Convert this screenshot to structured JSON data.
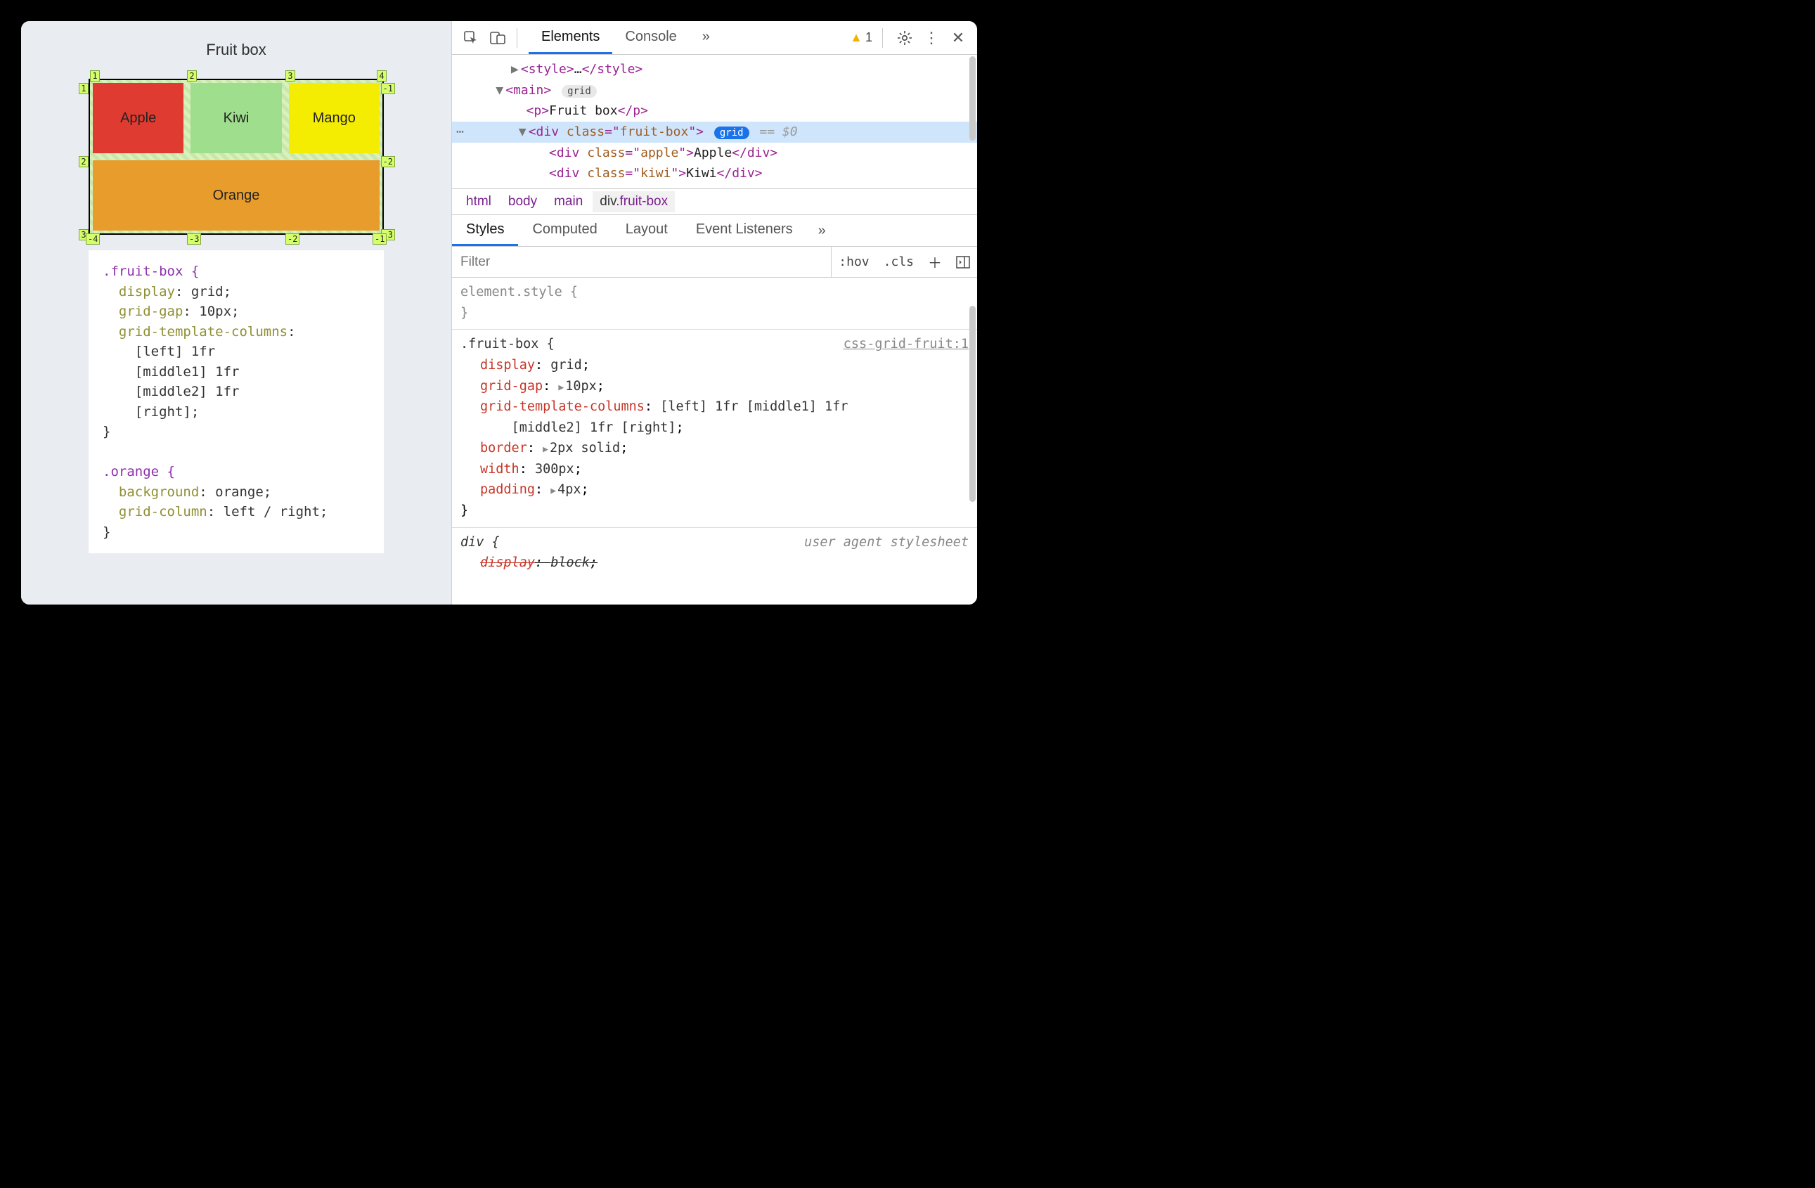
{
  "viewport": {
    "title": "Fruit box",
    "cells": {
      "apple": "Apple",
      "kiwi": "Kiwi",
      "mango": "Mango",
      "orange": "Orange"
    },
    "grid_numbers": {
      "top": [
        "1",
        "2",
        "3",
        "4"
      ],
      "left": [
        "1",
        "2",
        "3"
      ],
      "right": [
        "-1",
        "-2",
        "-3"
      ],
      "bottom": [
        "-4",
        "-3",
        "-2",
        "-1"
      ]
    },
    "css_sample": {
      "rule1_selector": ".fruit-box {",
      "rule1_lines": [
        "display: grid;",
        "grid-gap: 10px;",
        "grid-template-columns:",
        "  [left] 1fr",
        "  [middle1] 1fr",
        "  [middle2] 1fr",
        "  [right];"
      ],
      "rule1_close": "}",
      "rule2_selector": ".orange {",
      "rule2_lines": [
        "background: orange;",
        "grid-column: left / right;"
      ],
      "rule2_close": "}"
    }
  },
  "devtools": {
    "tabs": {
      "elements": "Elements",
      "console": "Console"
    },
    "more_chevrons": "»",
    "warning_count": "1",
    "dom": {
      "l1": "▶<style>…</style>",
      "l2_open": "▼<main>",
      "grid_badge": "grid",
      "l3": "<p>Fruit box</p>",
      "l4_open_pre": "▼<div class=\"",
      "l4_class": "fruit-box",
      "l4_open_post": "\"> ",
      "l4_eq": " == $0",
      "l5_a": "<div class=\"",
      "l5_b": "apple",
      "l5_c": "\">Apple</div>",
      "l6_a": "<div class=\"",
      "l6_b": "kiwi",
      "l6_c": "\">Kiwi</div>"
    },
    "breadcrumb": [
      "html",
      "body",
      "main",
      "div.fruit-box"
    ],
    "styles_tabs": [
      "Styles",
      "Computed",
      "Layout",
      "Event Listeners"
    ],
    "filter_placeholder": "Filter",
    "filter_buttons": {
      "hov": ":hov",
      "cls": ".cls"
    },
    "styles": {
      "element_style": "element.style {",
      "close": "}",
      "rule_selector": ".fruit-box {",
      "rule_src": "css-grid-fruit:1",
      "props": [
        {
          "name": "display",
          "value": "grid",
          "expand": false
        },
        {
          "name": "grid-gap",
          "value": "10px",
          "expand": true
        },
        {
          "name": "grid-template-columns",
          "value": "[left] 1fr [middle1] 1fr",
          "cont": "[middle2] 1fr [right]",
          "expand": false,
          "multiline": true
        },
        {
          "name": "border",
          "value": "2px solid",
          "expand": true
        },
        {
          "name": "width",
          "value": "300px",
          "expand": false
        },
        {
          "name": "padding",
          "value": "4px",
          "expand": true
        }
      ],
      "ua_selector": "div {",
      "ua_label": "user agent stylesheet",
      "ua_prop_name": "display",
      "ua_prop_value": "block"
    }
  }
}
